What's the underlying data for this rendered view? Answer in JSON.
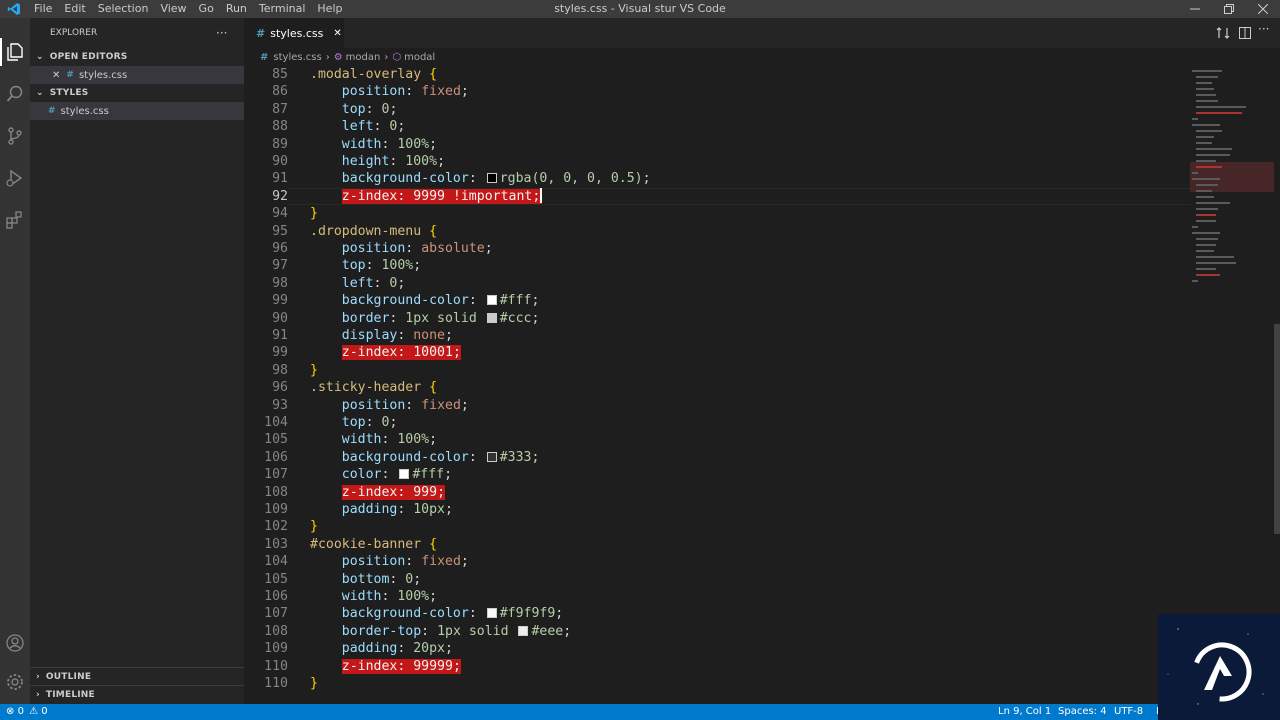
{
  "window": {
    "title": "styles.css - Visual stur VS Code"
  },
  "menu": [
    "File",
    "Edit",
    "Selection",
    "View",
    "Go",
    "Run",
    "Terminal",
    "Help"
  ],
  "sidebar": {
    "title": "EXPLORER",
    "open_editors": "OPEN EDITORS",
    "open_file": "styles.css",
    "folder": "STYLES",
    "folder_file": "styles.css",
    "outline": "OUTLINE",
    "timeline": "TIMELINE"
  },
  "tab": {
    "label": "styles.css"
  },
  "breadcrumb": {
    "file": "styles.css",
    "part1": "modan",
    "part2": "modal"
  },
  "editor": {
    "line_numbers": [
      "85",
      "86",
      "87",
      "88",
      "89",
      "90",
      "91",
      "92",
      "94",
      "95",
      "96",
      "97",
      "98",
      "99",
      "90",
      "91",
      "99",
      "98",
      "96",
      "93",
      "104",
      "105",
      "106",
      "107",
      "108",
      "109",
      "102",
      "103",
      "104",
      "105",
      "106",
      "107",
      "108",
      "109",
      "110",
      "110"
    ],
    "active_line_number": "92",
    "colors": {
      "rgba": "#000000",
      "fff": "#ffffff",
      "ccc": "#cccccc",
      "c333": "#333333",
      "f9f9f9": "#f9f9f9",
      "eee": "#eeeeee",
      "highlight": "#c41818"
    },
    "lines": [
      {
        "sel": ".modal-overlay",
        "brace": " {"
      },
      {
        "prop": "position",
        "val": "fixed"
      },
      {
        "prop": "top",
        "val": "0"
      },
      {
        "prop": "left",
        "val": "0"
      },
      {
        "prop": "width",
        "val": "100%"
      },
      {
        "prop": "height",
        "val": "100%"
      },
      {
        "prop": "background-color",
        "val": "rgba(0, 0, 0, 0.5)"
      },
      {
        "prop": "z-index",
        "val": "9999 !important"
      },
      {
        "brace": "}"
      },
      {
        "sel": ".dropdown-menu",
        "brace": " {"
      },
      {
        "prop": "position",
        "val": "absolute"
      },
      {
        "prop": "top",
        "val": "100%"
      },
      {
        "prop": "left",
        "val": "0"
      },
      {
        "prop": "background-color",
        "val": "#fff"
      },
      {
        "prop": "border",
        "val": "1px solid",
        "val2": "#ccc"
      },
      {
        "prop": "display",
        "val": "none"
      },
      {
        "prop": "z-index",
        "val": "10001"
      },
      {
        "brace": "}"
      },
      {
        "sel": ".sticky-header",
        "brace": " {"
      },
      {
        "prop": "position",
        "val": "fixed"
      },
      {
        "prop": "top",
        "val": "0"
      },
      {
        "prop": "width",
        "val": "100%"
      },
      {
        "prop": "background-color",
        "val": "#333"
      },
      {
        "prop": "color",
        "val": "#fff"
      },
      {
        "prop": "z-index",
        "val": "999"
      },
      {
        "prop": "padding",
        "val": "10px"
      },
      {
        "brace": "}"
      },
      {
        "sel": "#cookie-banner",
        "brace": " {"
      },
      {
        "prop": "position",
        "val": "fixed"
      },
      {
        "prop": "bottom",
        "val": "0"
      },
      {
        "prop": "width",
        "val": "100%"
      },
      {
        "prop": "background-color",
        "val": "#f9f9f9"
      },
      {
        "prop": "border-top",
        "val": "1px solid",
        "val2": "#eee"
      },
      {
        "prop": "padding",
        "val": "20px"
      },
      {
        "prop": "z-index",
        "val": "99999"
      },
      {
        "brace": "}"
      }
    ]
  },
  "status": {
    "errors": "0",
    "warnings": "0",
    "position": "Ln 9, Col 1",
    "spaces": "Spaces: 4",
    "encoding": "UTF-8",
    "eol": "L"
  }
}
